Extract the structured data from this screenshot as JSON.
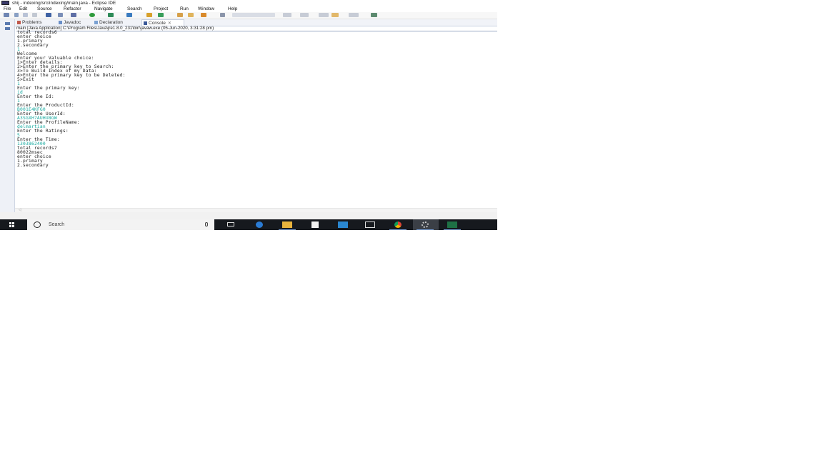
{
  "window": {
    "title": "shij - indexing/src/indexing/main.java - Eclipse IDE"
  },
  "menu": [
    "File",
    "Edit",
    "Source",
    "Refactor",
    "Navigate",
    "Search",
    "Project",
    "Run",
    "Window",
    "Help"
  ],
  "tabs": [
    {
      "label": "Problems",
      "active": false
    },
    {
      "label": "Javadoc",
      "active": false
    },
    {
      "label": "Declaration",
      "active": false
    },
    {
      "label": "Console",
      "active": true
    }
  ],
  "console": {
    "launch_info": "main [Java Application] C:\\Program Files\\Java\\jre1.8.0_231\\bin\\javaw.exe (05-Jun-2020, 3:31:28 pm)",
    "lines": [
      {
        "text": "total records6",
        "type": "out"
      },
      {
        "text": "enter choice",
        "type": "out"
      },
      {
        "text": "1.primary",
        "type": "out"
      },
      {
        "text": "2.secondary",
        "type": "out"
      },
      {
        "text": "1",
        "type": "in"
      },
      {
        "text": "Welcome",
        "type": "out"
      },
      {
        "text": "Enter your Valuable choice:",
        "type": "out"
      },
      {
        "text": "1>Enter details:",
        "type": "out"
      },
      {
        "text": "2>Enter the primary key to Search:",
        "type": "out"
      },
      {
        "text": "3>To Build Index of my Data:",
        "type": "out"
      },
      {
        "text": "4>Enter the primary key to be Deleted:",
        "type": "out"
      },
      {
        "text": "5>Exit",
        "type": "out"
      },
      {
        "text": "1",
        "type": "in"
      },
      {
        "text": "Enter the primary key:",
        "type": "out"
      },
      {
        "text": "id",
        "type": "in"
      },
      {
        "text": "Enter the Id:",
        "type": "out"
      },
      {
        "text": "1",
        "type": "in"
      },
      {
        "text": "Enter the ProductId:",
        "type": "out"
      },
      {
        "text": "B001E4KFG0",
        "type": "in"
      },
      {
        "text": "Enter the UserId:",
        "type": "out"
      },
      {
        "text": "A3SGXH7AUHU8GW",
        "type": "in"
      },
      {
        "text": "Enter the ProfileName:",
        "type": "out"
      },
      {
        "text": "delmartian",
        "type": "in"
      },
      {
        "text": "Enter the Ratings:",
        "type": "out"
      },
      {
        "text": "5",
        "type": "in"
      },
      {
        "text": "Enter the Time:",
        "type": "out"
      },
      {
        "text": "1303862400",
        "type": "in"
      },
      {
        "text": "total records7",
        "type": "out"
      },
      {
        "text": "80022msec",
        "type": "out"
      },
      {
        "text": "enter choice",
        "type": "out"
      },
      {
        "text": "1.primary",
        "type": "out"
      },
      {
        "text": "2.secondary",
        "type": "out"
      }
    ]
  },
  "taskbar": {
    "search_placeholder": "Search",
    "apps": [
      "task-view",
      "edge",
      "file-explorer",
      "store",
      "mail",
      "window",
      "chrome",
      "eclipse",
      "excel"
    ],
    "active_app": "eclipse"
  },
  "colors": {
    "console_input": "#13a89e",
    "console_output": "#1a1a1a",
    "taskbar": "#16191e"
  }
}
